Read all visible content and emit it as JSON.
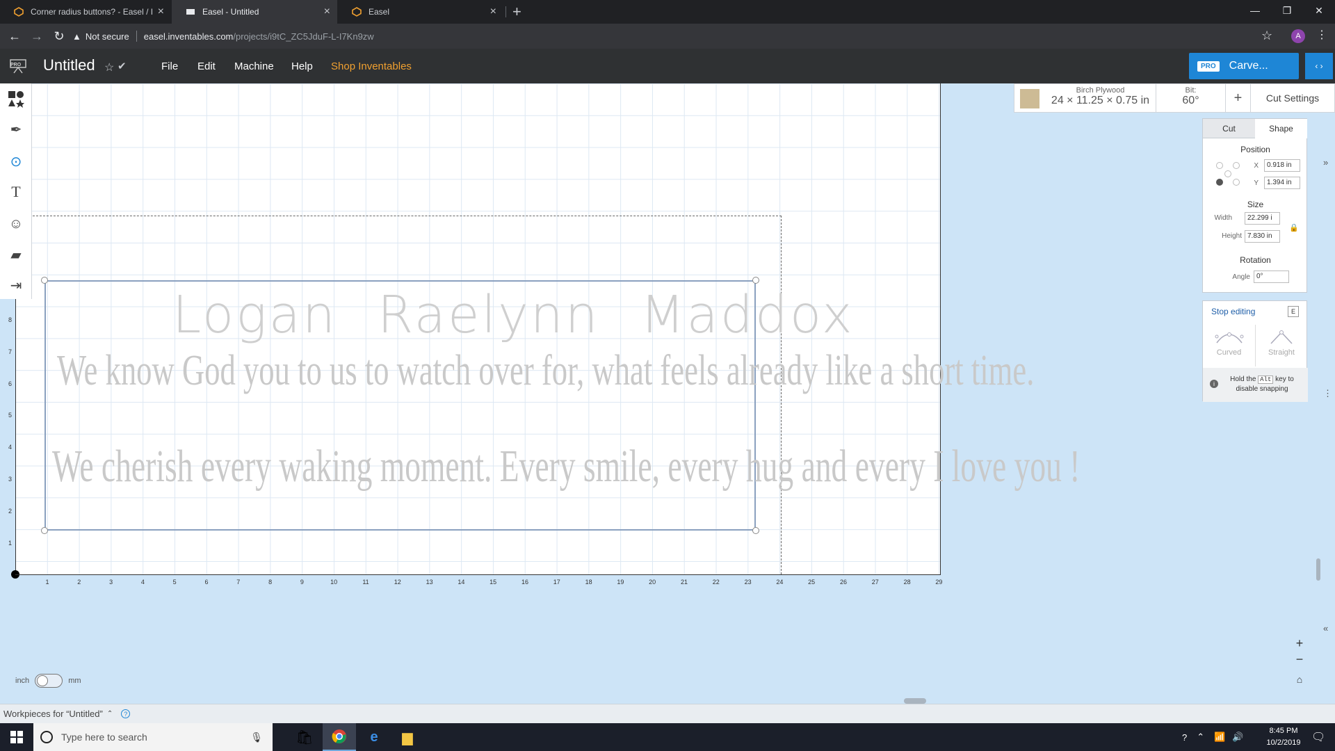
{
  "browser": {
    "tabs": [
      {
        "label": "Corner radius buttons? - Easel / I"
      },
      {
        "label": "Easel - Untitled"
      },
      {
        "label": "Easel"
      }
    ],
    "security_label": "Not secure",
    "url_host": "easel.inventables.com",
    "url_path": "/projects/i9tC_ZC5JduF-L-I7Kn9zw",
    "profile_initial": "A"
  },
  "app": {
    "pro_badge": "PRO",
    "doc_title": "Untitled",
    "menu": {
      "file": "File",
      "edit": "Edit",
      "machine": "Machine",
      "help": "Help",
      "shop": "Shop Inventables"
    },
    "carve_pro": "PRO",
    "carve_label": "Carve..."
  },
  "design": {
    "names": [
      "Logan",
      "Raelynn",
      "Maddox"
    ],
    "line1": "We know God you to us to watch over for, what feels already like a short time.",
    "line2": "We cherish every waking moment.  Every smile, every hug and every I love you !"
  },
  "rulers": {
    "x": [
      "1",
      "2",
      "3",
      "4",
      "5",
      "6",
      "7",
      "8",
      "9",
      "10",
      "11",
      "12",
      "13",
      "14",
      "15",
      "16",
      "17",
      "18",
      "19",
      "20",
      "21",
      "22",
      "23",
      "24",
      "25",
      "26",
      "27",
      "28",
      "29"
    ],
    "y": [
      "8",
      "7",
      "6",
      "5",
      "4",
      "3",
      "2",
      "1"
    ]
  },
  "units": {
    "left": "inch",
    "right": "mm"
  },
  "material": {
    "name": "Birch Plywood",
    "dims": "24 × 11.25 × 0.75 in",
    "bit_label": "Bit:",
    "bit_value": "60°",
    "cut_settings": "Cut Settings",
    "swatch_color": "#cdbb95"
  },
  "shape_panel": {
    "tab_cut": "Cut",
    "tab_shape": "Shape",
    "position_title": "Position",
    "x_label": "X",
    "x_value": "0.918 in",
    "y_label": "Y",
    "y_value": "1.394 in",
    "size_title": "Size",
    "width_label": "Width",
    "width_value": "22.299 i",
    "height_label": "Height",
    "height_value": "7.830 in",
    "rotation_title": "Rotation",
    "angle_label": "Angle",
    "angle_value": "0°"
  },
  "edit_panel": {
    "stop_editing": "Stop editing",
    "key": "E",
    "curved": "Curved",
    "straight": "Straight",
    "tip_prefix": "Hold the",
    "tip_key": "Alt",
    "tip_suffix": "key to disable snapping"
  },
  "workpieces": {
    "label": "Workpieces for “Untitled”"
  },
  "taskbar": {
    "search_placeholder": "Type here to search",
    "time": "8:45 PM",
    "date": "10/2/2019"
  },
  "colors": {
    "accent": "#1e86d6",
    "shop": "#f0a030",
    "header_bg": "#2f3133",
    "canvas_bg": "#cde4f7"
  }
}
